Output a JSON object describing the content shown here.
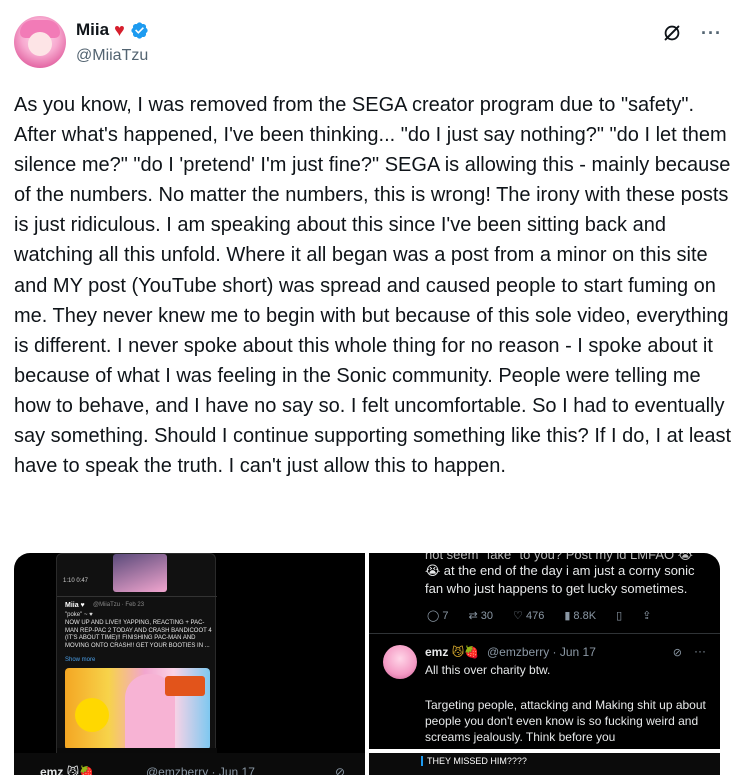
{
  "author": {
    "display_name": "Miia",
    "heart": "♥",
    "handle": "@MiiaTzu",
    "verified_color": "#1d9bf0"
  },
  "actions": {
    "grok_icon": "grok-icon",
    "more": "···"
  },
  "post_text": "As you know, I was removed from the SEGA creator program due to \"safety\". After what's happened, I've been thinking... \"do I just say nothing?\" \"do I let them silence me?\" \"do I 'pretend' I'm just fine?\" SEGA is allowing this - mainly because of the numbers. No matter the numbers, this is wrong! The irony with these posts is just ridiculous. I am speaking about this since I've been sitting back and watching all this unfold. Where it all began was a post from a minor on this site and MY post (YouTube short) was spread and caused people to start fuming on me. They never knew me to begin with but because of this sole video, everything is different. I never spoke about this whole thing for no reason - I spoke about it because of what I was feeling in the Sonic community. People were telling me how to behave, and I have no say so. I felt uncomfortable. So I had to eventually say something. Should I continue supporting something like this? If I do, I at least have to speak the truth. I can't just allow this to happen.",
  "media": {
    "tile_a": {
      "time": "1:10 0:47",
      "mini_name": "Miia ♥",
      "mini_handle": "@MiiaTzu · Feb 23",
      "mini_quote": "\"poke\" ~ ♥",
      "mini_body": "NOW UP AND LIVE!! YAPPING, REACTING + PAC-MAN REP-PAC 2 TODAY AND CRASH BANDICOOT 4 (IT'S ABOUT TIME)!! FINISHING PAC-MAN AND MOVING ONTO CRASH!! GET YOUR BOOTIES IN ...",
      "mini_more": "Show more",
      "nav": [
        "⌂",
        "⌕",
        "⊘",
        "♫",
        "✉"
      ]
    },
    "tile_b": {
      "top_text": "not seem \"fake\" to you? Post my id LMFAO 😭",
      "line1": "😭 at the end of the day i am just a corny sonic",
      "line2": "fan who just happens to get lucky sometimes.",
      "stats": {
        "replies": "7",
        "reposts": "30",
        "likes": "476",
        "views": "8.8K"
      },
      "reply_name": "emz",
      "reply_emojis": "😼🍓",
      "reply_handle": "@emzberry · Jun 17",
      "reply_line": "All this over charity btw.",
      "reply_body": "Targeting people, attacking and Making shit up about people you don't even know is so fucking weird and screams jealously. Think before you"
    },
    "tile_a_strip": {
      "name": "emz 😼🍓",
      "handle": "@emzberry · Jun 17"
    },
    "tile_d": {
      "text": "THEY MISSED HIM????"
    }
  }
}
